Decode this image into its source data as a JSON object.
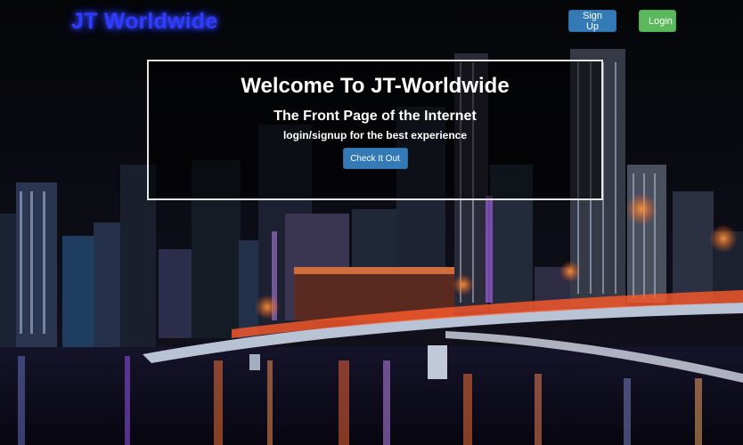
{
  "header": {
    "brand": "JT Worldwide",
    "signup_label": "Sign Up",
    "login_label": "Login"
  },
  "hero": {
    "title": "Welcome To JT-Worldwide",
    "subtitle": "The Front Page of the Internet",
    "tagline": "login/signup for the best experience",
    "cta_label": "Check It Out"
  },
  "colors": {
    "brand": "#2f3bff",
    "signup": "#337ab7",
    "login": "#5cb85c",
    "cta": "#337ab7"
  },
  "background": {
    "icon": "night-city-skyline-image"
  }
}
